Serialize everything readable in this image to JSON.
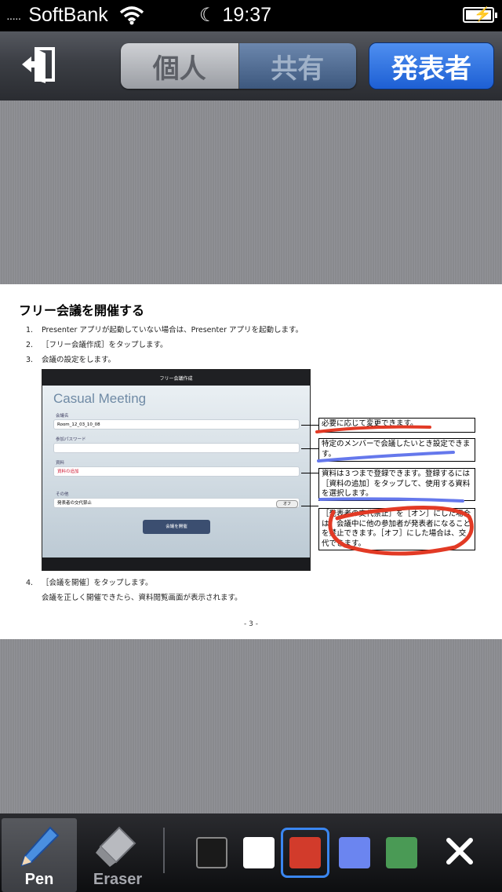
{
  "status_bar": {
    "carrier": "SoftBank",
    "signal_dots": "·····",
    "time": "19:37"
  },
  "nav": {
    "segments": [
      "個人",
      "共有"
    ],
    "selected_segment": "共有",
    "presenter_button": "発表者"
  },
  "document": {
    "title": "フリー会議を開催する",
    "steps": [
      {
        "num": "1.",
        "text": "Presenter アプリが起動していない場合は、Presenter アプリを起動します。"
      },
      {
        "num": "2.",
        "text": "［フリー会議作成］をタップします。"
      },
      {
        "num": "3.",
        "text": "会議の設定をします。"
      },
      {
        "num": "4.",
        "text": "［会議を開催］をタップします。"
      }
    ],
    "step4_detail": "会議を正しく開催できたら、資料閲覧画面が表示されます。",
    "page_number": "- 3 -",
    "embedded_screenshot": {
      "header": "フリー会議作成",
      "app_title": "Casual Meeting",
      "fields": [
        {
          "label": "会議名",
          "value": "Room_12_03_10_08"
        },
        {
          "label": "参加パスワード",
          "value": ""
        },
        {
          "label": "資料",
          "value": "資料の追加"
        },
        {
          "label": "その他",
          "value": "発表者の交代禁止"
        }
      ],
      "toggle": "オフ",
      "start_button": "会議を開催"
    },
    "callouts": [
      "必要に応じて変更できます。",
      "特定のメンバーで会議したいとき設定できます。",
      "資料は３つまで登録できます。登録するには［資料の追加］をタップして、使用する資料を選択します。",
      "［発表者の交代禁止］を［オン］にした場合は、会議中に他の参加者が発表者になることを禁止できます。［オフ］にした場合は、交代できます。"
    ]
  },
  "toolbar": {
    "pen_label": "Pen",
    "eraser_label": "Eraser",
    "colors": [
      "#1a1a1a",
      "#ffffff",
      "#d23b2b",
      "#6b85f0",
      "#4a9a55"
    ],
    "selected_color": "#d23b2b",
    "accent": "#3a86f0"
  }
}
